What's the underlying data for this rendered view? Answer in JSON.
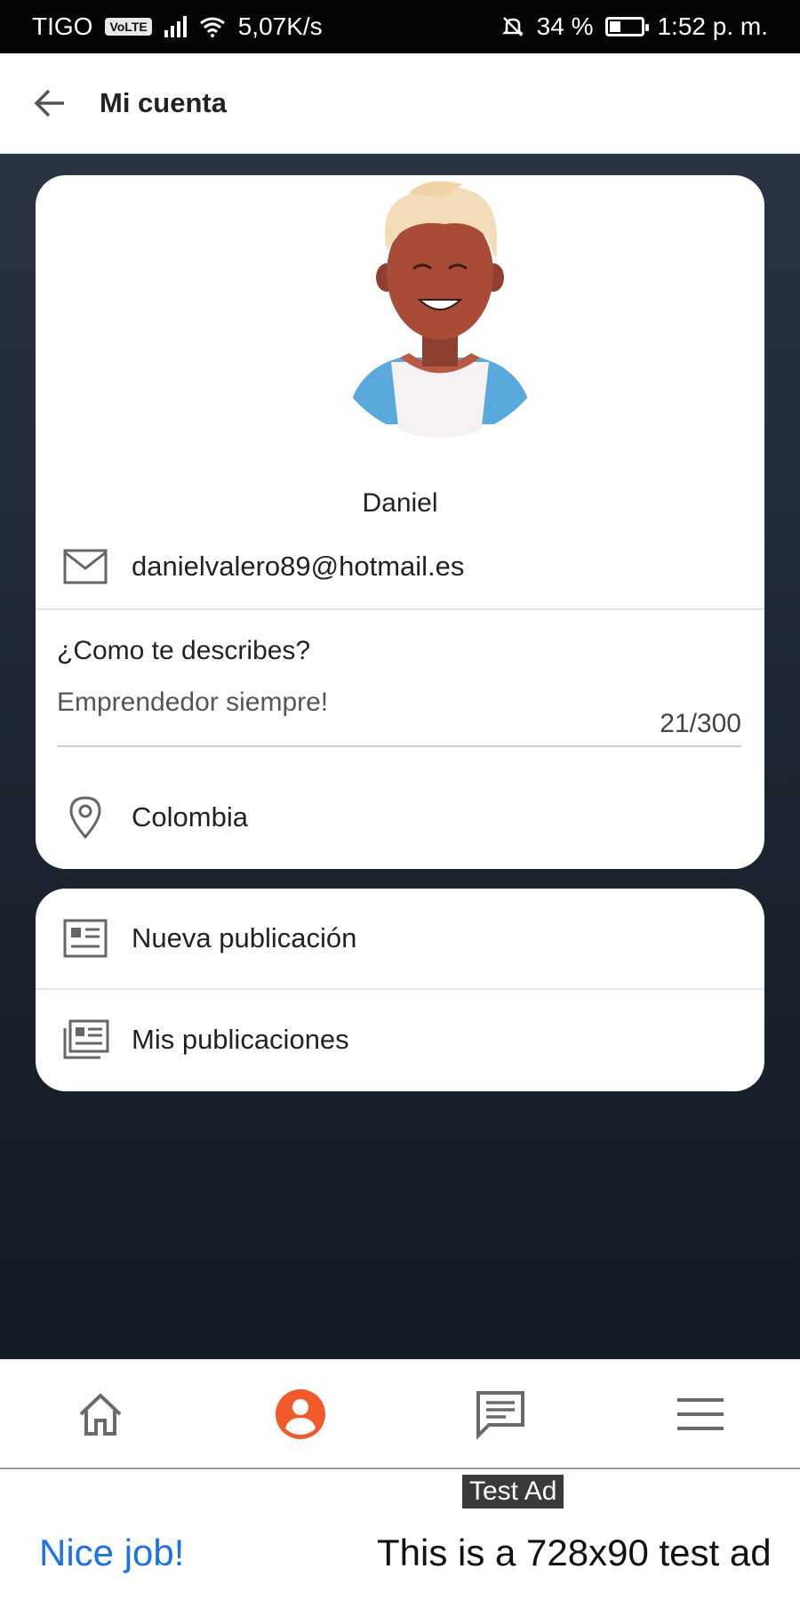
{
  "status_bar": {
    "carrier": "TIGO",
    "network_badge": "VoLTE",
    "speed": "5,07K/s",
    "battery": "34 %",
    "battery_level": 0.34,
    "time": "1:52 p. m."
  },
  "app_bar": {
    "title": "Mi cuenta",
    "back_icon": "arrow-left-icon"
  },
  "profile": {
    "name": "Daniel",
    "email": "danielvalero89@hotmail.es",
    "describe_label": "¿Como te describes?",
    "describe_value": "Emprendedor siempre!",
    "char_counter": "21/300",
    "location": "Colombia"
  },
  "actions": [
    {
      "label": "Nueva publicación",
      "icon": "article-icon"
    },
    {
      "label": "Mis publicaciones",
      "icon": "articles-stack-icon"
    }
  ],
  "bottom_nav": {
    "items": [
      {
        "icon": "home-icon",
        "active": false
      },
      {
        "icon": "account-icon",
        "active": true
      },
      {
        "icon": "chat-icon",
        "active": false
      },
      {
        "icon": "menu-icon",
        "active": false
      }
    ],
    "active_color": "#f15a2b",
    "inactive_color": "#6a6a6a"
  },
  "ad": {
    "label": "Test Ad",
    "headline": "Nice job!",
    "body": "This is a 728x90 test ad"
  },
  "colors": {
    "accent": "#f15a2b",
    "ad_link": "#1a73e8",
    "background_top": "#2a3442",
    "background_bottom": "#131b25"
  }
}
